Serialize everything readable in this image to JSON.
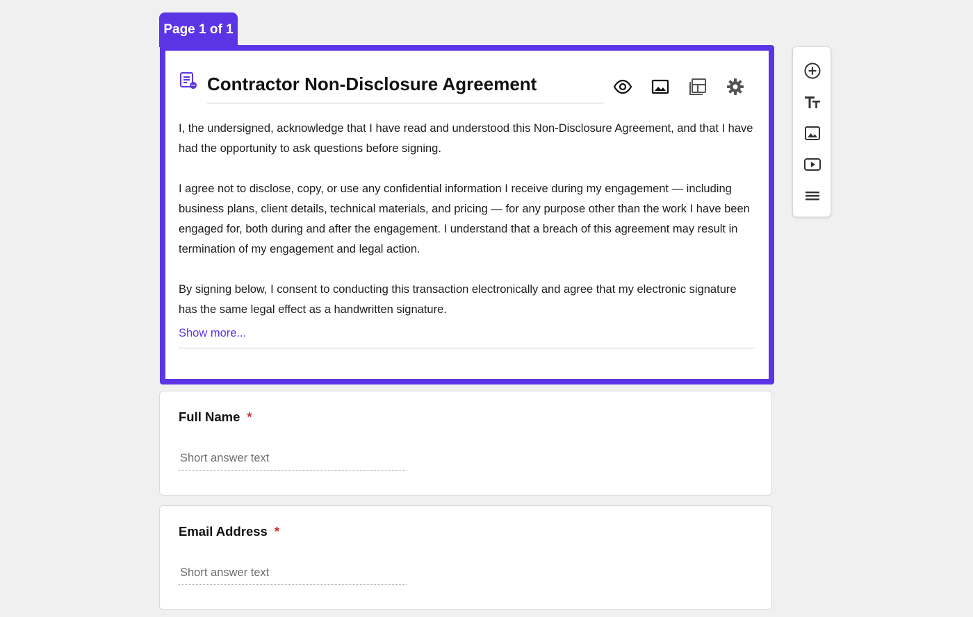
{
  "page_tab": {
    "label": "Page 1 of 1"
  },
  "form": {
    "title": "Contractor Non-Disclosure Agreement",
    "description": [
      "I, the undersigned, acknowledge that I have read and understood this Non-Disclosure Agreement, and that I have had the opportunity to ask questions before signing.",
      "I agree not to disclose, copy, or use any confidential information I receive during my engagement — including business plans, client details, technical materials, and pricing — for any purpose other than the work I have been engaged for, both during and after the engagement. I understand that a breach of this agreement may result in termination of my engagement and legal action.",
      "By signing below, I consent to conducting this transaction electronically and agree that my electronic signature has the same legal effect as a handwritten signature."
    ],
    "show_more_label": "Show more..."
  },
  "header_tools": [
    {
      "icon": "eye-icon"
    },
    {
      "icon": "image-icon"
    },
    {
      "icon": "layout-icon"
    },
    {
      "icon": "gear-icon"
    }
  ],
  "side_toolbar": [
    {
      "icon": "add-circle-icon"
    },
    {
      "icon": "text-size-icon"
    },
    {
      "icon": "image-icon"
    },
    {
      "icon": "video-icon"
    },
    {
      "icon": "section-icon"
    }
  ],
  "questions": [
    {
      "label": "Full Name",
      "required_mark": "*",
      "placeholder": "Short answer text",
      "value": ""
    },
    {
      "label": "Email Address",
      "required_mark": "*",
      "placeholder": "Short answer text",
      "value": ""
    }
  ],
  "colors": {
    "accent": "#5b34e6",
    "required": "#d42a2a",
    "background": "#f0f0f0"
  }
}
